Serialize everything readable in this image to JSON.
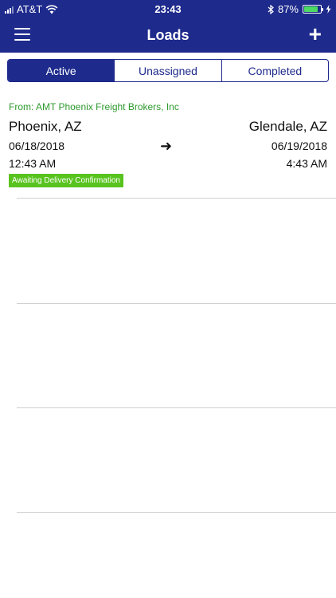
{
  "status_bar": {
    "carrier": "AT&T",
    "time": "23:43",
    "battery_percent": "87%",
    "battery_level": 0.87,
    "icons": [
      "signal-icon",
      "wifi-icon",
      "bluetooth-icon",
      "battery-icon",
      "charging-icon"
    ]
  },
  "nav": {
    "title": "Loads",
    "add_label": "+"
  },
  "tabs": [
    {
      "label": "Active",
      "selected": true
    },
    {
      "label": "Unassigned",
      "selected": false
    },
    {
      "label": "Completed",
      "selected": false
    }
  ],
  "loads": [
    {
      "from": "From: AMT Phoenix Freight Brokers, Inc",
      "origin_city": "Phoenix, AZ",
      "destination_city": "Glendale, AZ",
      "pickup_date": "06/18/2018",
      "pickup_time": "12:43 AM",
      "delivery_date": "06/19/2018",
      "delivery_time": "4:43 AM",
      "arrow": "➜",
      "status": "Awaiting Delivery Confirmation"
    }
  ],
  "colors": {
    "brand": "#1e2a8c",
    "from_text": "#2e9a2e",
    "status_badge": "#58c31f",
    "battery": "#4cd964"
  }
}
